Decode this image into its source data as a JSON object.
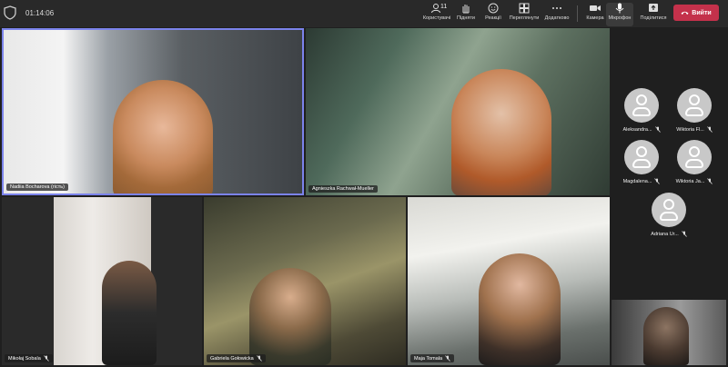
{
  "meeting": {
    "timer": "01:14:06"
  },
  "toolbar": {
    "participants_count": "11",
    "participants_label": "Користувачі",
    "raise_label": "Підняти",
    "react_label": "Реакції",
    "view_label": "Переглянути",
    "more_label": "Додатково",
    "camera_label": "Камера",
    "mic_label": "Мікрофон",
    "share_label": "Поділитися",
    "leave_label": "Вийти"
  },
  "tiles": [
    {
      "name": "Nadiia Bocharova (гість)"
    },
    {
      "name": "Agnieszka Rachwał-Mueller"
    },
    {
      "name": "Mikołaj Sobala"
    },
    {
      "name": "Gabriela Gołowicka"
    },
    {
      "name": "Maja Tomala"
    }
  ],
  "side_participants": [
    {
      "name": "Aleksandra..."
    },
    {
      "name": "Wiktoria Fl..."
    },
    {
      "name": "Magdalena..."
    },
    {
      "name": "Wiktoria Ja..."
    },
    {
      "name": "Adriana Ur..."
    }
  ],
  "colors": {
    "leave": "#c4314b",
    "active_speaker": "#7b83eb",
    "topbar": "#292929",
    "background": "#1f1f1f"
  }
}
